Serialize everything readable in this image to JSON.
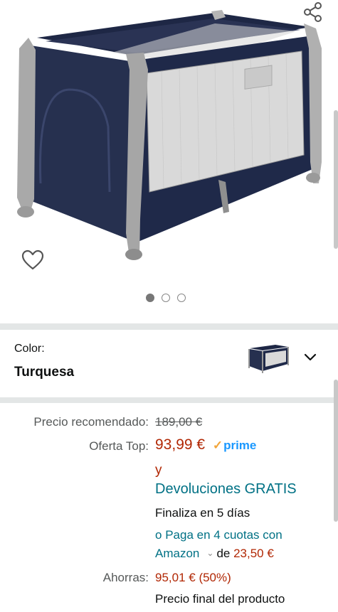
{
  "gallery": {
    "icons": {
      "share": "share-icon",
      "favorite": "heart-icon"
    },
    "image_count": 3,
    "active_image": 1
  },
  "color": {
    "label": "Color:",
    "value": "Turquesa"
  },
  "price": {
    "recommended_label": "Precio recomendado:",
    "recommended_value": "189,00 €",
    "offer_label": "Oferta Top:",
    "offer_value": "93,99 €",
    "prime_check": "✓",
    "prime_text": "prime",
    "and_text": "y",
    "returns_text": "Devoluciones GRATIS",
    "ends_text": "Finaliza en 5 días",
    "installments_prefix": "o",
    "installments_link_1": "Paga en 4 cuotas con",
    "installments_link_2": "Amazon",
    "installments_chevron": "⌄",
    "installments_de": "de",
    "installments_amount": "23,50 €",
    "savings_label": "Ahorras:",
    "savings_value": "95,01 € (50%)",
    "final_price_text": "Precio final del producto"
  },
  "colors": {
    "price_red": "#b12704",
    "link_teal": "#007185",
    "prime_blue": "#1a98ff",
    "prime_check": "#f2a53a",
    "divider": "#e3e6e6"
  }
}
